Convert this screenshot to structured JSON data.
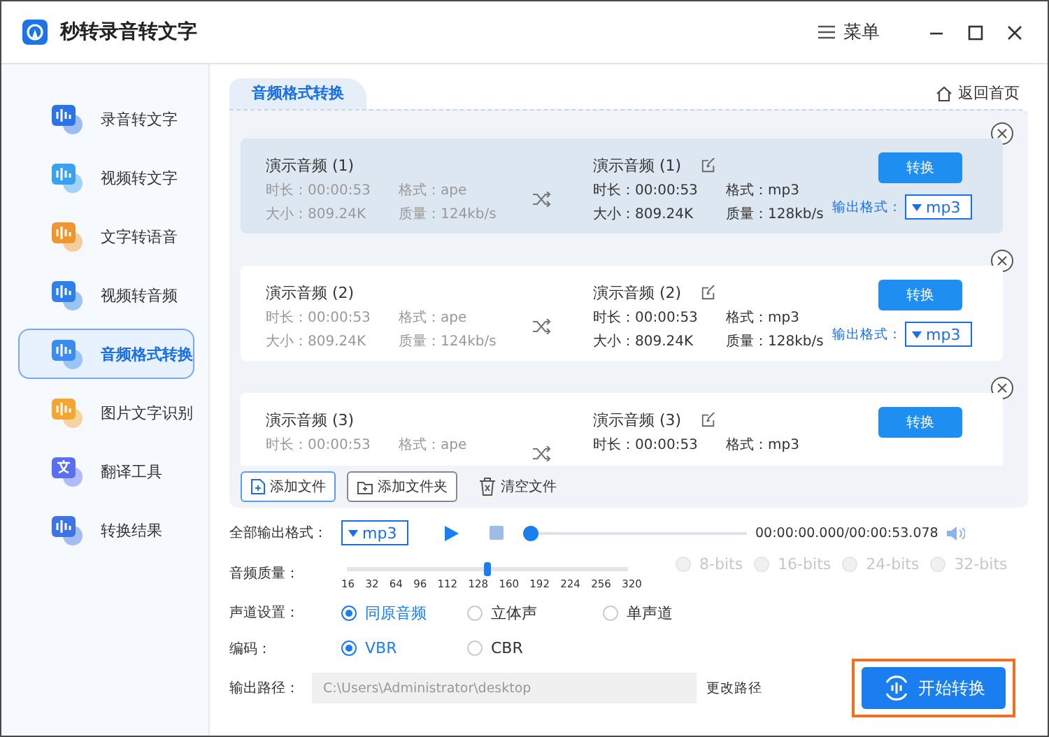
{
  "app": {
    "title": "秒转录音转文字",
    "menu": "菜单"
  },
  "sidebar": {
    "items": [
      {
        "label": "录音转文字",
        "selected": false
      },
      {
        "label": "视频转文字",
        "selected": false
      },
      {
        "label": "文字转语音",
        "selected": false
      },
      {
        "label": "视频转音频",
        "selected": false
      },
      {
        "label": "音频格式转换",
        "selected": true
      },
      {
        "label": "图片文字识别",
        "selected": false
      },
      {
        "label": "翻译工具",
        "selected": false
      },
      {
        "label": "转换结果",
        "selected": false
      }
    ]
  },
  "main": {
    "tab": "音频格式转换",
    "home": "返回首页",
    "files": [
      {
        "selected": true,
        "source": {
          "name": "演示音频 (1)",
          "lines": [
            "时长：00:00:53",
            "格式：ape",
            "大小：809.24K",
            "质量：124kb/s"
          ]
        },
        "target": {
          "name": "演示音频 (1)",
          "lines": [
            "时长：00:00:53",
            "格式：mp3",
            "大小：809.24K",
            "质量：128kb/s"
          ]
        },
        "button": "转换",
        "output_label": "输出格式：",
        "output_format": "mp3"
      },
      {
        "selected": false,
        "source": {
          "name": "演示音频 (2)",
          "lines": [
            "时长：00:00:53",
            "格式：ape",
            "大小：809.24K",
            "质量：124kb/s"
          ]
        },
        "target": {
          "name": "演示音频 (2)",
          "lines": [
            "时长：00:00:53",
            "格式：mp3",
            "大小：809.24K",
            "质量：128kb/s"
          ]
        },
        "button": "转换",
        "output_label": "输出格式：",
        "output_format": "mp3"
      },
      {
        "selected": false,
        "source": {
          "name": "演示音频 (3)",
          "lines": [
            "时长：00:00:53",
            "格式：ape"
          ]
        },
        "target": {
          "name": "演示音频 (3)",
          "lines": [
            "时长：00:00:53",
            "格式：mp3"
          ]
        },
        "button": "转换"
      }
    ],
    "toolbar": [
      {
        "kind": "file",
        "label": "添加文件"
      },
      {
        "kind": "folder",
        "label": "添加文件夹"
      },
      {
        "kind": "clear",
        "label": "清空文件"
      }
    ]
  },
  "settings": {
    "all_format": {
      "label": "全部输出格式：",
      "value": "mp3"
    },
    "player": {
      "level": 0,
      "time": "00:00:00.000/00:00:53.078"
    },
    "quality": {
      "label": "音频质量：",
      "level": 0.5,
      "ticks": [
        "16",
        "32",
        "64",
        "96",
        "112",
        "128",
        "160",
        "192",
        "224",
        "256",
        "320"
      ],
      "bits": [
        {
          "label": "8-bits",
          "selected": false,
          "disabled": true
        },
        {
          "label": "16-bits",
          "selected": false,
          "disabled": true
        },
        {
          "label": "24-bits",
          "selected": false,
          "disabled": true
        },
        {
          "label": "32-bits",
          "selected": false,
          "disabled": true
        }
      ]
    },
    "channel": {
      "label": "声道设置：",
      "options": [
        {
          "label": "同原音频",
          "selected": true
        },
        {
          "label": "立体声",
          "selected": false
        },
        {
          "label": "单声道",
          "selected": false
        }
      ]
    },
    "encoding": {
      "label": "编码：",
      "options": [
        {
          "label": "VBR",
          "selected": true
        },
        {
          "label": "CBR",
          "selected": false
        }
      ]
    },
    "output": {
      "label": "输出路径：",
      "value": "C:\\Users\\Administrator\\desktop",
      "change": "更改路径"
    },
    "start": "开始转换"
  }
}
